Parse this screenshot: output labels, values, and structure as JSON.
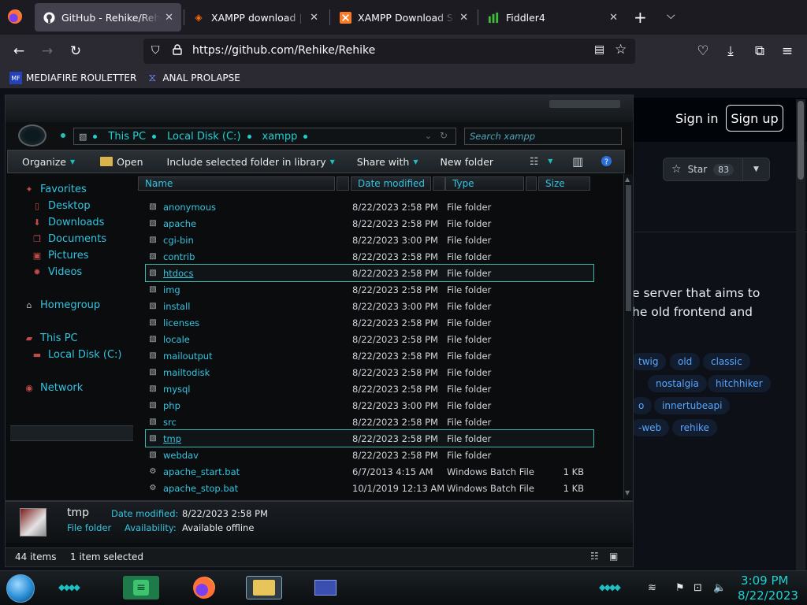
{
  "browser": {
    "tabs": [
      {
        "title": "GitHub - Rehike/Rehike",
        "icon": "github-icon",
        "active": true
      },
      {
        "title": "XAMPP download | SourceForge.net",
        "icon": "sourceforge-icon",
        "active": false
      },
      {
        "title": "XAMPP Download Success",
        "icon": "xampp-icon",
        "active": false
      },
      {
        "title": "Fiddler4",
        "icon": "fiddler-icon",
        "active": false
      }
    ],
    "url": "https://github.com/Rehike/Rehike",
    "bookmarks": [
      {
        "label": "MEDIAFIRE ROULETTER",
        "icon_text": "MF"
      },
      {
        "label": "ANAL PROLAPSE",
        "icon_text": ""
      }
    ]
  },
  "github": {
    "sign_in": "Sign in",
    "sign_up": "Sign up",
    "star_label": "Star",
    "star_count": "83",
    "description_line1": "e server that aims to",
    "description_line2": "he old frontend and",
    "topics": [
      "twig",
      "old",
      "classic",
      "nostalgia",
      "hitchhiker",
      "o",
      "innertubeapi",
      "-web",
      "rehike"
    ]
  },
  "explorer": {
    "breadcrumbs": [
      "This PC",
      "Local Disk (C:)",
      "xampp"
    ],
    "search_placeholder": "Search xampp",
    "toolbar": {
      "organize": "Organize",
      "open": "Open",
      "include": "Include selected folder in library",
      "share": "Share with",
      "new_folder": "New folder"
    },
    "nav": {
      "favorites": "Favorites",
      "desktop": "Desktop",
      "downloads": "Downloads",
      "documents": "Documents",
      "pictures": "Pictures",
      "videos": "Videos",
      "homegroup": "Homegroup",
      "this_pc": "This PC",
      "local_disk": "Local Disk (C:)",
      "network": "Network"
    },
    "columns": {
      "name": "Name",
      "date": "Date modified",
      "type": "Type",
      "size": "Size"
    },
    "rows": [
      {
        "name": "anonymous",
        "date": "8/22/2023 2:58 PM",
        "type": "File folder",
        "size": ""
      },
      {
        "name": "apache",
        "date": "8/22/2023 2:58 PM",
        "type": "File folder",
        "size": ""
      },
      {
        "name": "cgi-bin",
        "date": "8/22/2023 3:00 PM",
        "type": "File folder",
        "size": ""
      },
      {
        "name": "contrib",
        "date": "8/22/2023 2:58 PM",
        "type": "File folder",
        "size": ""
      },
      {
        "name": "htdocs",
        "date": "8/22/2023 2:58 PM",
        "type": "File folder",
        "size": ""
      },
      {
        "name": "img",
        "date": "8/22/2023 2:58 PM",
        "type": "File folder",
        "size": ""
      },
      {
        "name": "install",
        "date": "8/22/2023 3:00 PM",
        "type": "File folder",
        "size": ""
      },
      {
        "name": "licenses",
        "date": "8/22/2023 2:58 PM",
        "type": "File folder",
        "size": ""
      },
      {
        "name": "locale",
        "date": "8/22/2023 2:58 PM",
        "type": "File folder",
        "size": ""
      },
      {
        "name": "mailoutput",
        "date": "8/22/2023 2:58 PM",
        "type": "File folder",
        "size": ""
      },
      {
        "name": "mailtodisk",
        "date": "8/22/2023 2:58 PM",
        "type": "File folder",
        "size": ""
      },
      {
        "name": "mysql",
        "date": "8/22/2023 2:58 PM",
        "type": "File folder",
        "size": ""
      },
      {
        "name": "php",
        "date": "8/22/2023 3:00 PM",
        "type": "File folder",
        "size": ""
      },
      {
        "name": "src",
        "date": "8/22/2023 2:58 PM",
        "type": "File folder",
        "size": ""
      },
      {
        "name": "tmp",
        "date": "8/22/2023 2:58 PM",
        "type": "File folder",
        "size": ""
      },
      {
        "name": "webdav",
        "date": "8/22/2023 2:58 PM",
        "type": "File folder",
        "size": ""
      },
      {
        "name": "apache_start.bat",
        "date": "6/7/2013 4:15 AM",
        "type": "Windows Batch File",
        "size": "1 KB"
      },
      {
        "name": "apache_stop.bat",
        "date": "10/1/2019 12:13 AM",
        "type": "Windows Batch File",
        "size": "1 KB"
      }
    ],
    "details": {
      "name": "tmp",
      "kind": "File folder",
      "date_label": "Date modified:",
      "date_value": "8/22/2023 2:58 PM",
      "avail_label": "Availability:",
      "avail_value": "Available offline"
    },
    "status": {
      "items": "44 items",
      "selected": "1 item selected"
    }
  },
  "taskbar": {
    "time": "3:09 PM",
    "date": "8/22/2023"
  }
}
